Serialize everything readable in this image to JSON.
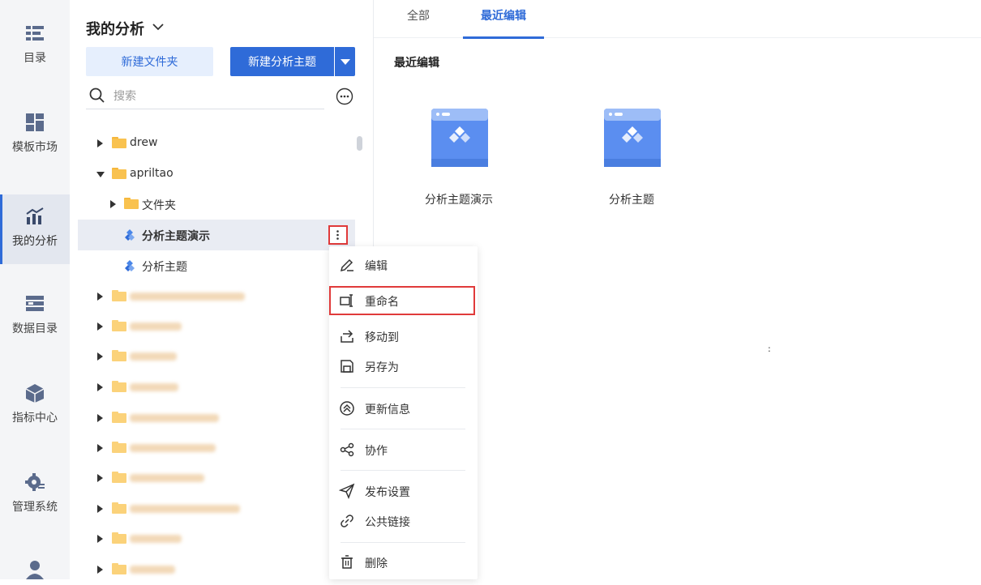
{
  "rail": {
    "items": [
      {
        "label": "目录",
        "icon": "catalog-icon"
      },
      {
        "label": "模板市场",
        "icon": "template-market-icon"
      },
      {
        "label": "我的分析",
        "icon": "analysis-chart-icon"
      },
      {
        "label": "数据目录",
        "icon": "data-catalog-icon"
      },
      {
        "label": "指标中心",
        "icon": "metrics-center-icon"
      },
      {
        "label": "管理系统",
        "icon": "management-gear-icon"
      }
    ],
    "active_index": 2
  },
  "panel": {
    "title": "我的分析",
    "new_folder_label": "新建文件夹",
    "new_theme_label": "新建分析主题",
    "search_placeholder": "搜索"
  },
  "tree": {
    "drew": "drew",
    "apriltao": "apriltao",
    "folder": "文件夹",
    "theme_demo": "分析主题演示",
    "theme": "分析主题"
  },
  "tabs": [
    {
      "label": "全部"
    },
    {
      "label": "最近编辑"
    }
  ],
  "active_tab": 1,
  "main": {
    "section_title": "最近编辑",
    "cards": [
      {
        "name": "分析主题演示"
      },
      {
        "name": "分析主题"
      }
    ]
  },
  "menu": {
    "items": [
      {
        "label": "编辑",
        "icon": "edit-icon"
      },
      {
        "label": "重命名",
        "icon": "rename-icon"
      },
      {
        "label": "移动到",
        "icon": "move-to-icon"
      },
      {
        "label": "另存为",
        "icon": "save-as-icon"
      },
      {
        "label": "更新信息",
        "icon": "update-info-icon"
      },
      {
        "label": "协作",
        "icon": "share-icon"
      },
      {
        "label": "发布设置",
        "icon": "publish-icon"
      },
      {
        "label": "公共链接",
        "icon": "link-icon"
      },
      {
        "label": "删除",
        "icon": "trash-icon"
      }
    ]
  },
  "stray_mark": ":",
  "colors": {
    "accent": "#2f6bd8",
    "highlight_border": "#e03a3a",
    "folder": "#f9c24f"
  }
}
